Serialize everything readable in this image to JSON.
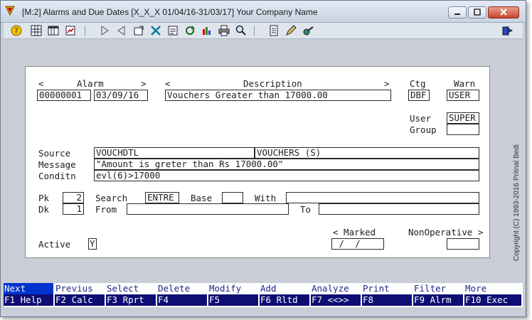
{
  "window": {
    "title": "[M:2]  Alarms and Due Dates  [X_X_X  01/04/16-31/03/17]  Your Company Name"
  },
  "toolbar": {
    "icons": [
      "help-icon",
      "grid-icon",
      "table-icon",
      "report-icon",
      "play-icon",
      "back-icon",
      "properties-icon",
      "tools-icon",
      "notes-icon",
      "refresh-icon",
      "chart-icon",
      "print-icon",
      "search-icon",
      "document-icon",
      "edit-icon",
      "settings-icon",
      "exit-icon"
    ]
  },
  "form": {
    "headers": {
      "alarm_left": "<",
      "alarm": "Alarm",
      "alarm_right": ">",
      "desc_left": "<",
      "description": "Description",
      "desc_right": ">",
      "ctg": "Ctg",
      "warn": "Warn"
    },
    "alarm_no": "00000001",
    "alarm_date": "03/09/16",
    "description": "Vouchers Greater than 17000.00",
    "ctg": "DBF",
    "warn": "USER",
    "user_label": "User",
    "user": "SUPER",
    "group_label": "Group",
    "group": "",
    "source_label": "Source",
    "source": "VOUCHDTL",
    "source2": "VOUCHERS (S)",
    "message_label": "Message",
    "message": "\"Amount is greter than Rs 17000.00\"",
    "condition_label": "Conditn",
    "condition": "evl(6)>17000",
    "pk_label": "Pk",
    "pk": "2",
    "dk_label": "Dk",
    "dk": "1",
    "search_label": "Search",
    "search": "ENTRE",
    "base_label": "Base",
    "base": "",
    "with_label": "With",
    "with": "",
    "from_label": "From",
    "from": "",
    "to_label": "To",
    "to": "",
    "marked_header": "< Marked",
    "nonop_header": "NonOperative >",
    "marked": " /  /",
    "nonoperative": "",
    "active_label": "Active",
    "active": "Y"
  },
  "copyright": "Copyright (C) 1993-2016  Pritnal Bedi",
  "fkeys": [
    {
      "top": "Next",
      "bottom": "F1 Help"
    },
    {
      "top": "Previus",
      "bottom": "F2 Calc"
    },
    {
      "top": "Select",
      "bottom": "F3 Rprt"
    },
    {
      "top": "Delete",
      "bottom": "F4"
    },
    {
      "top": "Modify",
      "bottom": "F5"
    },
    {
      "top": "Add",
      "bottom": "F6 Rltd"
    },
    {
      "top": "Analyze",
      "bottom": "F7 <<>>"
    },
    {
      "top": "Print",
      "bottom": "F8"
    },
    {
      "top": "Filter",
      "bottom": "F9 Alrm"
    },
    {
      "top": "More",
      "bottom": "F10 Exec"
    }
  ],
  "colors": {
    "fkey_bottom": "#0d0d73",
    "fkey_active": "#0033cc",
    "window_bg": "#c9ced6"
  }
}
